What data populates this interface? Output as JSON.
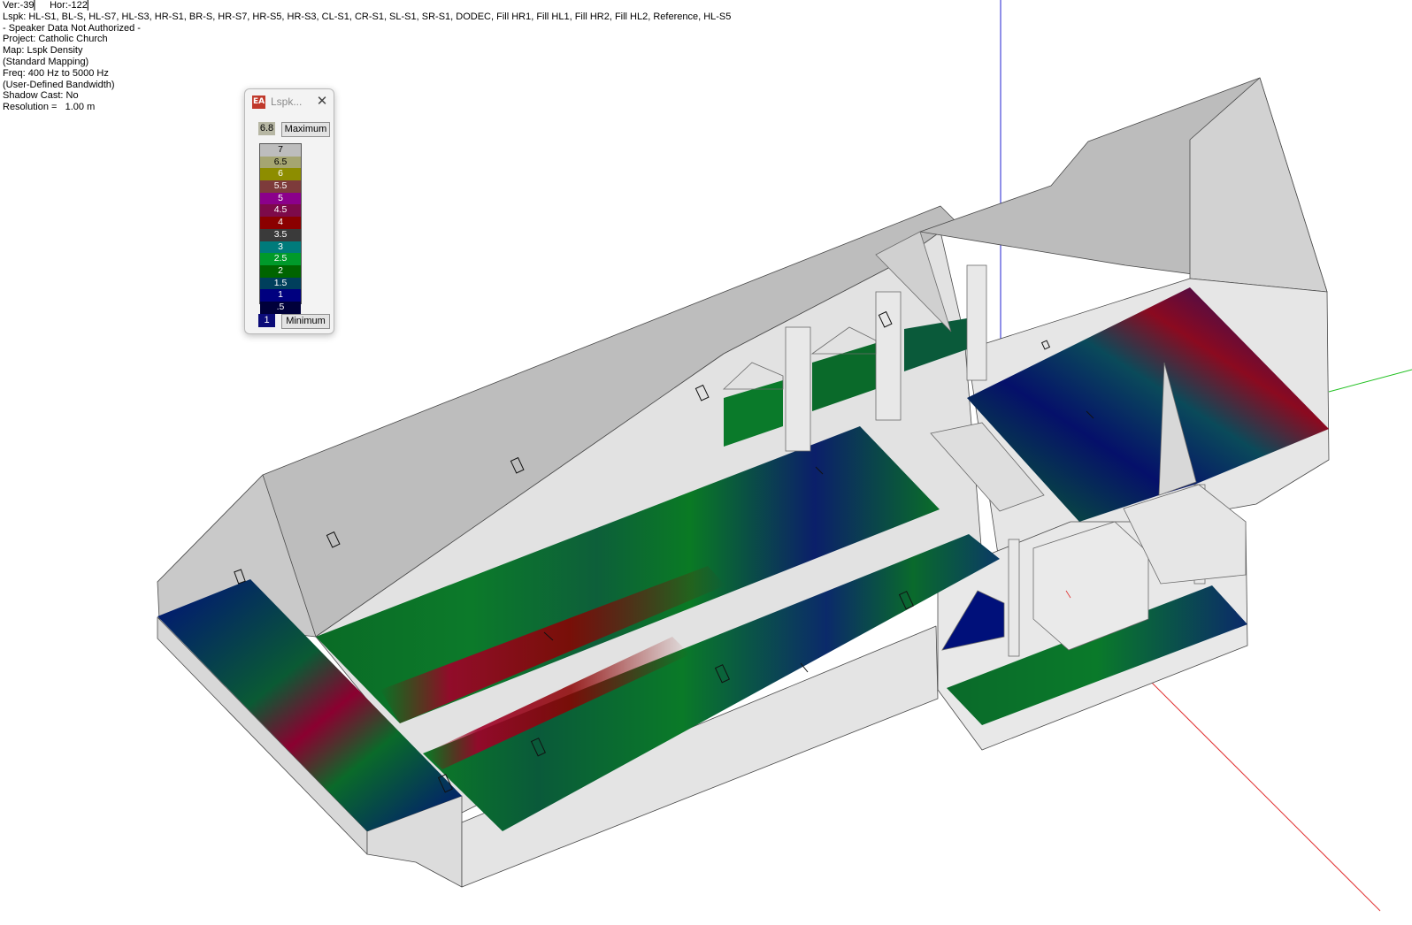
{
  "info": {
    "lines": [
      "Ver:-39▏   Hor:-122▏",
      "Lspk: HL-S1, BL-S, HL-S7, HL-S3, HR-S1, BR-S, HR-S7, HR-S5, HR-S3, CL-S1, CR-S1, SL-S1, SR-S1, DODEC, Fill HR1, Fill HL1, Fill HR2, Fill HL2, Reference, HL-S5",
      "- Speaker Data Not Authorized -",
      "Project: Catholic Church",
      "Map: Lspk Density",
      "(Standard Mapping)",
      "Freq: 400 Hz to 5000 Hz",
      "(User-Defined Bandwidth)",
      "Shadow Cast: No",
      "Resolution =   1.00 m"
    ]
  },
  "legend": {
    "title": "Lspk...",
    "app_icon": "ease-app-icon",
    "max_value": "6.8",
    "max_button": "Maximum",
    "min_value": "1",
    "min_button": "Minimum",
    "scale": [
      {
        "label": "7",
        "color": "#bdbdbd",
        "text": "#000000"
      },
      {
        "label": "6.5",
        "color": "#a5a571",
        "text": "#000000"
      },
      {
        "label": "6",
        "color": "#8d8d00",
        "text": "#ffffff"
      },
      {
        "label": "5.5",
        "color": "#7d3b3b",
        "text": "#ffffff"
      },
      {
        "label": "5",
        "color": "#8b008b",
        "text": "#ffffff"
      },
      {
        "label": "4.5",
        "color": "#7d0a4a",
        "text": "#ffffff"
      },
      {
        "label": "4",
        "color": "#8b0000",
        "text": "#ffffff"
      },
      {
        "label": "3.5",
        "color": "#3a3a3a",
        "text": "#ffffff"
      },
      {
        "label": "3",
        "color": "#007b7b",
        "text": "#ffffff"
      },
      {
        "label": "2.5",
        "color": "#009a2a",
        "text": "#ffffff"
      },
      {
        "label": "2",
        "color": "#006400",
        "text": "#ffffff"
      },
      {
        "label": "1.5",
        "color": "#003f5c",
        "text": "#ffffff"
      },
      {
        "label": "1",
        "color": "#00007f",
        "text": "#ffffff"
      },
      {
        "label": ".5",
        "color": "#00003a",
        "text": "#ffffff"
      }
    ]
  },
  "colors": {
    "axis_x": "#e03030",
    "axis_y": "#20c020",
    "axis_z": "#2020d0",
    "roof": "#bfbfbf",
    "wall": "#e2e2e2",
    "map_low": "#00007f",
    "map_mid": "#007a20",
    "map_high": "#8b0000"
  }
}
